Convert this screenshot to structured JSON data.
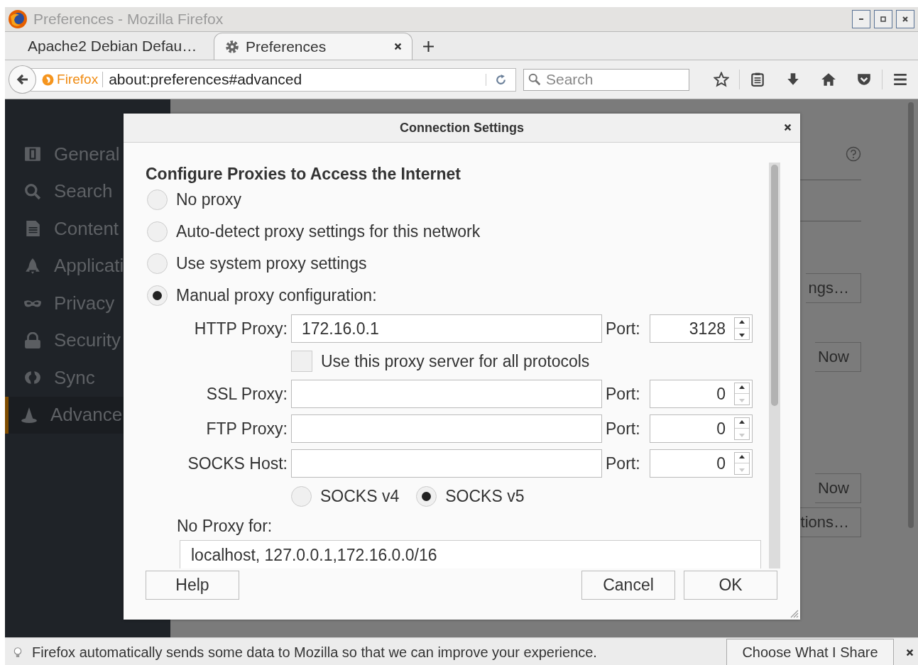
{
  "window": {
    "title": "Preferences - Mozilla Firefox"
  },
  "tabs": [
    {
      "label": "Apache2 Debian Defau…",
      "selected": false
    },
    {
      "label": "Preferences",
      "selected": true
    }
  ],
  "address_bar": {
    "identity": "Firefox",
    "url": "about:preferences#advanced"
  },
  "search": {
    "placeholder": "Search"
  },
  "sidebar": {
    "items": [
      {
        "label": "General",
        "selected": false
      },
      {
        "label": "Search",
        "selected": false
      },
      {
        "label": "Content",
        "selected": false
      },
      {
        "label": "Applicati",
        "selected": false
      },
      {
        "label": "Privacy",
        "selected": false
      },
      {
        "label": "Security",
        "selected": false
      },
      {
        "label": "Sync",
        "selected": false
      },
      {
        "label": "Advance",
        "selected": true
      }
    ]
  },
  "background": {
    "buttons": [
      "ngs…",
      "Now",
      "Now",
      "tions…"
    ]
  },
  "dialog": {
    "title": "Connection Settings",
    "heading": "Configure Proxies to Access the Internet",
    "modes": [
      {
        "label": "No proxy",
        "selected": false
      },
      {
        "label": "Auto-detect proxy settings for this network",
        "selected": false
      },
      {
        "label": "Use system proxy settings",
        "selected": false
      },
      {
        "label": "Manual proxy configuration:",
        "selected": true
      }
    ],
    "http": {
      "label": "HTTP Proxy:",
      "value": "172.16.0.1",
      "port_label": "Port:",
      "port": "3128"
    },
    "share_all": {
      "label": "Use this proxy server for all protocols",
      "checked": false
    },
    "proxies": [
      {
        "label": "SSL Proxy:",
        "port_label": "Port:",
        "port": "0"
      },
      {
        "label": "FTP Proxy:",
        "port_label": "Port:",
        "port": "0"
      },
      {
        "label": "SOCKS Host:",
        "port_label": "Port:",
        "port": "0"
      }
    ],
    "socks_versions": [
      {
        "label": "SOCKS v4",
        "selected": false
      },
      {
        "label": "SOCKS v5",
        "selected": true
      }
    ],
    "no_proxy": {
      "label": "No Proxy for:",
      "value": "localhost, 127.0.0.1,172.16.0.0/16"
    },
    "buttons": {
      "help": "Help",
      "cancel": "Cancel",
      "ok": "OK"
    }
  },
  "notification": {
    "text": "Firefox automatically sends some data to Mozilla so that we can improve your experience.",
    "button": "Choose What I Share"
  }
}
